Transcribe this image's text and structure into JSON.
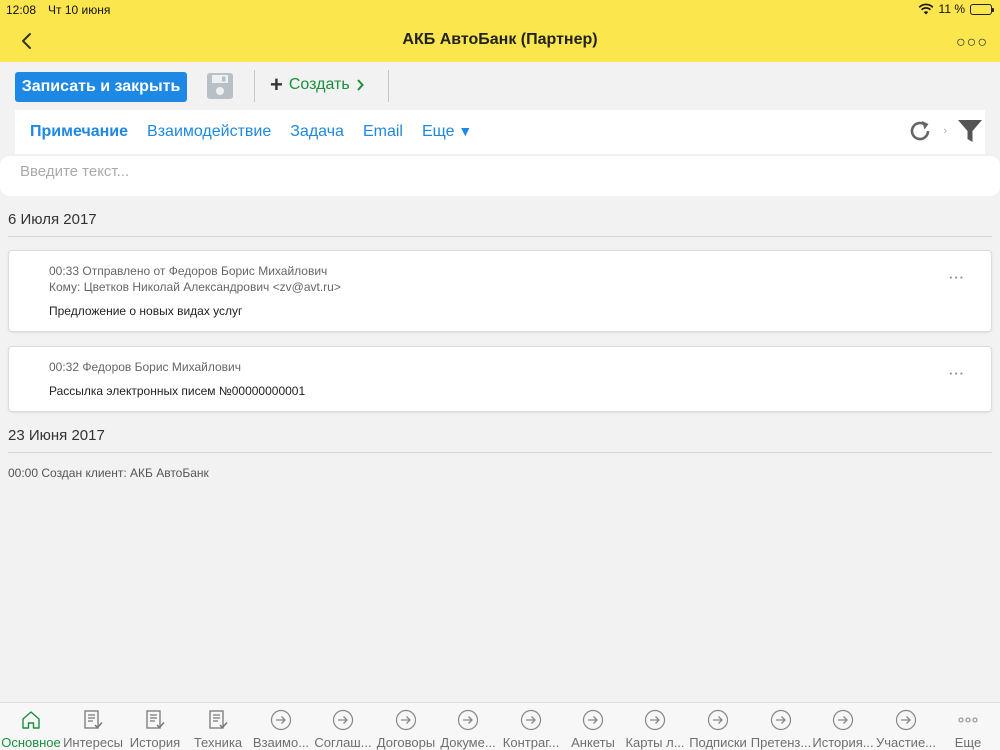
{
  "status": {
    "time": "12:08",
    "date": "Чт 10 июня",
    "battery": "11 %",
    "battery_level": 0.11
  },
  "header": {
    "title": "АКБ АвтоБанк (Партнер)",
    "back_icon": "chevron-left-icon",
    "more_icon": "ellipsis-icon",
    "more_label": "○○○"
  },
  "toolbar": {
    "save_close_label": "Записать и закрыть",
    "save_icon": "floppy-disk-icon",
    "create_label": "Создать",
    "create_chevron": "›"
  },
  "tabs": [
    {
      "label": "Примечание",
      "active": true
    },
    {
      "label": "Взаимодействие",
      "active": false
    },
    {
      "label": "Задача",
      "active": false
    },
    {
      "label": "Email",
      "active": false
    },
    {
      "label": "Еще",
      "active": false
    }
  ],
  "search": {
    "placeholder": "Введите текст..."
  },
  "groups": [
    {
      "date": "6 Июля 2017",
      "items": [
        {
          "meta_line1": "00:33 Отправлено от Федоров Борис Михайлович",
          "meta_line2": "Кому: Цветков Николай Александрович <zv@avt.ru>",
          "subject": "Предложение о новых видах услуг",
          "menu": "···"
        },
        {
          "meta_line1": "00:32 Федоров Борис Михайлович",
          "subject": "Рассылка электронных писем №00000000001",
          "menu": "···"
        }
      ]
    },
    {
      "date": "23 Июня 2017",
      "items": [
        {
          "event": "00:00 Создан клиент: АКБ АвтоБанк"
        }
      ]
    }
  ],
  "bottom_tabs": [
    {
      "label": "Основное",
      "icon": "home-icon",
      "active": true
    },
    {
      "label": "Интересы",
      "icon": "checklist-icon",
      "active": false
    },
    {
      "label": "История",
      "icon": "checklist-icon",
      "active": false
    },
    {
      "label": "Техника",
      "icon": "checklist-icon",
      "active": false
    },
    {
      "label": "Взаимо...",
      "icon": "arrow-circle-icon",
      "active": false
    },
    {
      "label": "Соглаш...",
      "icon": "arrow-circle-icon",
      "active": false
    },
    {
      "label": "Договоры",
      "icon": "arrow-circle-icon",
      "active": false
    },
    {
      "label": "Докуме...",
      "icon": "arrow-circle-icon",
      "active": false
    },
    {
      "label": "Контраг...",
      "icon": "arrow-circle-icon",
      "active": false
    },
    {
      "label": "Анкеты",
      "icon": "arrow-circle-icon",
      "active": false
    },
    {
      "label": "Карты л...",
      "icon": "arrow-circle-icon",
      "active": false
    },
    {
      "label": "Подписки",
      "icon": "arrow-circle-icon",
      "active": false
    },
    {
      "label": "Претенз...",
      "icon": "arrow-circle-icon",
      "active": false
    },
    {
      "label": "История...",
      "icon": "arrow-circle-icon",
      "active": false
    },
    {
      "label": "Участие...",
      "icon": "arrow-circle-icon",
      "active": false
    },
    {
      "label": "Еще",
      "icon": "ellipsis-icon",
      "active": false
    }
  ],
  "colors": {
    "header_bg": "#fbe64d",
    "primary_button": "#1e88e5",
    "link": "#1e88e5",
    "create_green": "#1a8f3c"
  }
}
